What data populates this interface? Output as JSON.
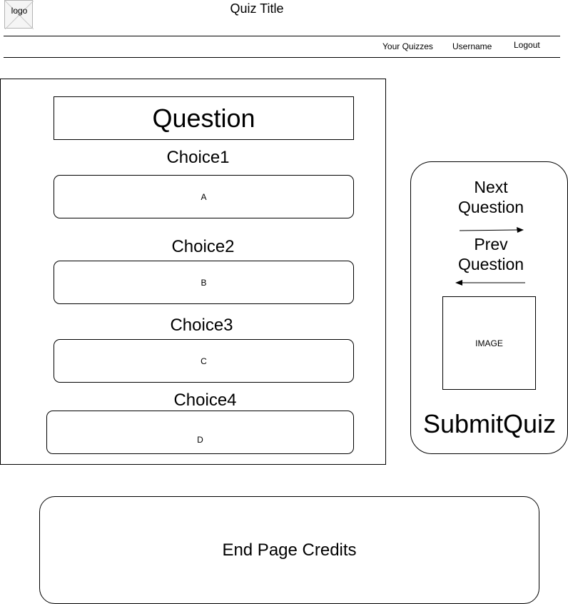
{
  "header": {
    "logo_label": "logo",
    "title": "Quiz Title",
    "nav": {
      "your_quizzes": "Your Quizzes",
      "username": "Username",
      "logout": "Logout"
    }
  },
  "question": {
    "title": "Question",
    "choices": [
      {
        "label": "Choice1",
        "value": "A"
      },
      {
        "label": "Choice2",
        "value": "B"
      },
      {
        "label": "Choice3",
        "value": "C"
      },
      {
        "label": "Choice4",
        "value": "D"
      }
    ]
  },
  "sidebar": {
    "next_line1": "Next",
    "next_line2": "Question",
    "prev_line1": "Prev",
    "prev_line2": "Question",
    "image_label": "IMAGE",
    "submit_label": "SubmitQuiz"
  },
  "footer": {
    "credits": "End Page Credits"
  }
}
